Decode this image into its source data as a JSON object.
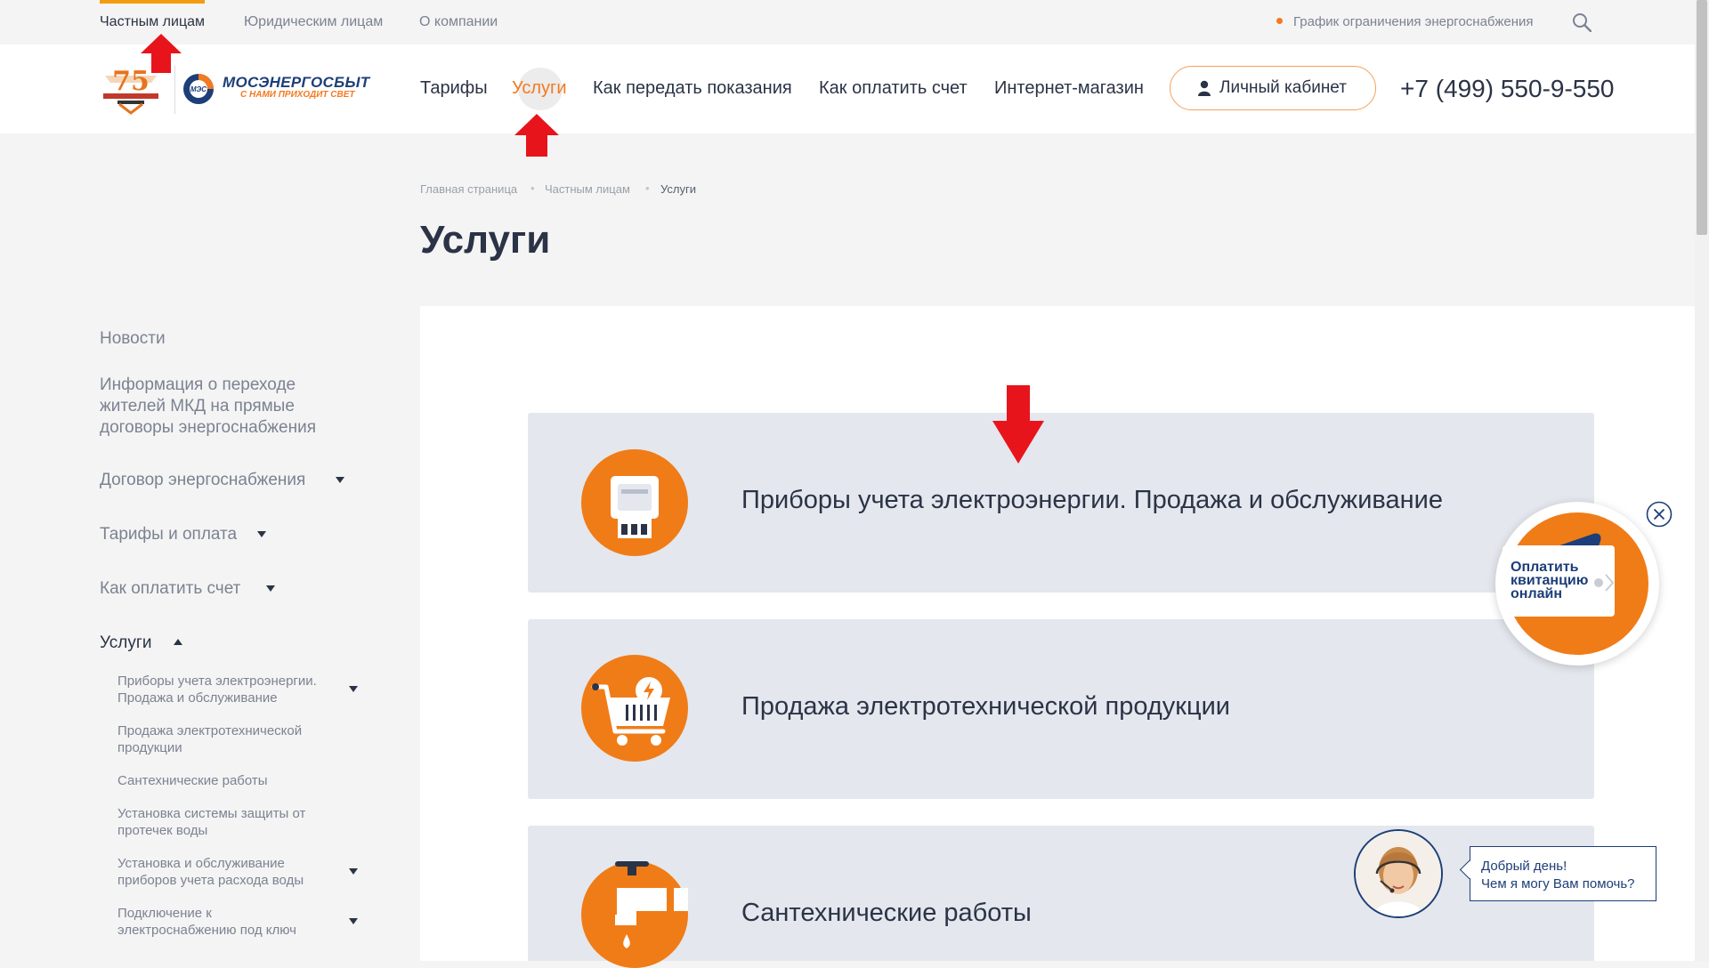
{
  "topbar": {
    "tabs": [
      "Частным лицам",
      "Юридическим лицам",
      "О компании"
    ],
    "schedule_link": "График ограничения энергоснабжения"
  },
  "logo": {
    "title": "МОСЭНЕРГОСБЫТ",
    "slogan": "С НАМИ ПРИХОДИТ СВЕТ",
    "badge": "МЭС",
    "anniversary": "75"
  },
  "nav": {
    "items": [
      "Тарифы",
      "Услуги",
      "Как передать показания",
      "Как оплатить счет",
      "Интернет-магазин"
    ],
    "cabinet": "Личный кабинет",
    "phone": "+7 (499) 550-9-550"
  },
  "breadcrumb": [
    "Главная страница",
    "Частным лицам",
    "Услуги"
  ],
  "page_title": "Услуги",
  "sidebar": {
    "items": [
      "Новости",
      "Информация о переходе жителей МКД на прямые договоры энергоснабжения",
      "Договор энергоснабжения",
      "Тарифы и оплата",
      "Как оплатить счет",
      "Услуги"
    ],
    "subitems": [
      "Приборы учета электроэнергии. Продажа и обслуживание",
      "Продажа электротехнической продукции",
      "Сантехнические работы",
      "Установка системы защиты от протечек воды",
      "Установка и обслуживание приборов учета расхода воды",
      "Подключение к электроснабжению под ключ"
    ]
  },
  "cards": [
    {
      "label": "Приборы учета электроэнергии. Продажа и обслуживание",
      "icon": "meter-icon"
    },
    {
      "label": "Продажа электротехнической продукции",
      "icon": "cart-icon"
    },
    {
      "label": "Сантехнические работы",
      "icon": "faucet-icon"
    }
  ],
  "pay_widget": {
    "label": "Оплатить квитанцию онлайн"
  },
  "chat": {
    "line1": "Добрый день!",
    "line2": "Чем я могу Вам помочь?"
  },
  "colors": {
    "accent": "#f47920",
    "brand_blue": "#1d3e78",
    "card_bg": "#e4e7ed",
    "arrow_red": "#e8141c"
  }
}
